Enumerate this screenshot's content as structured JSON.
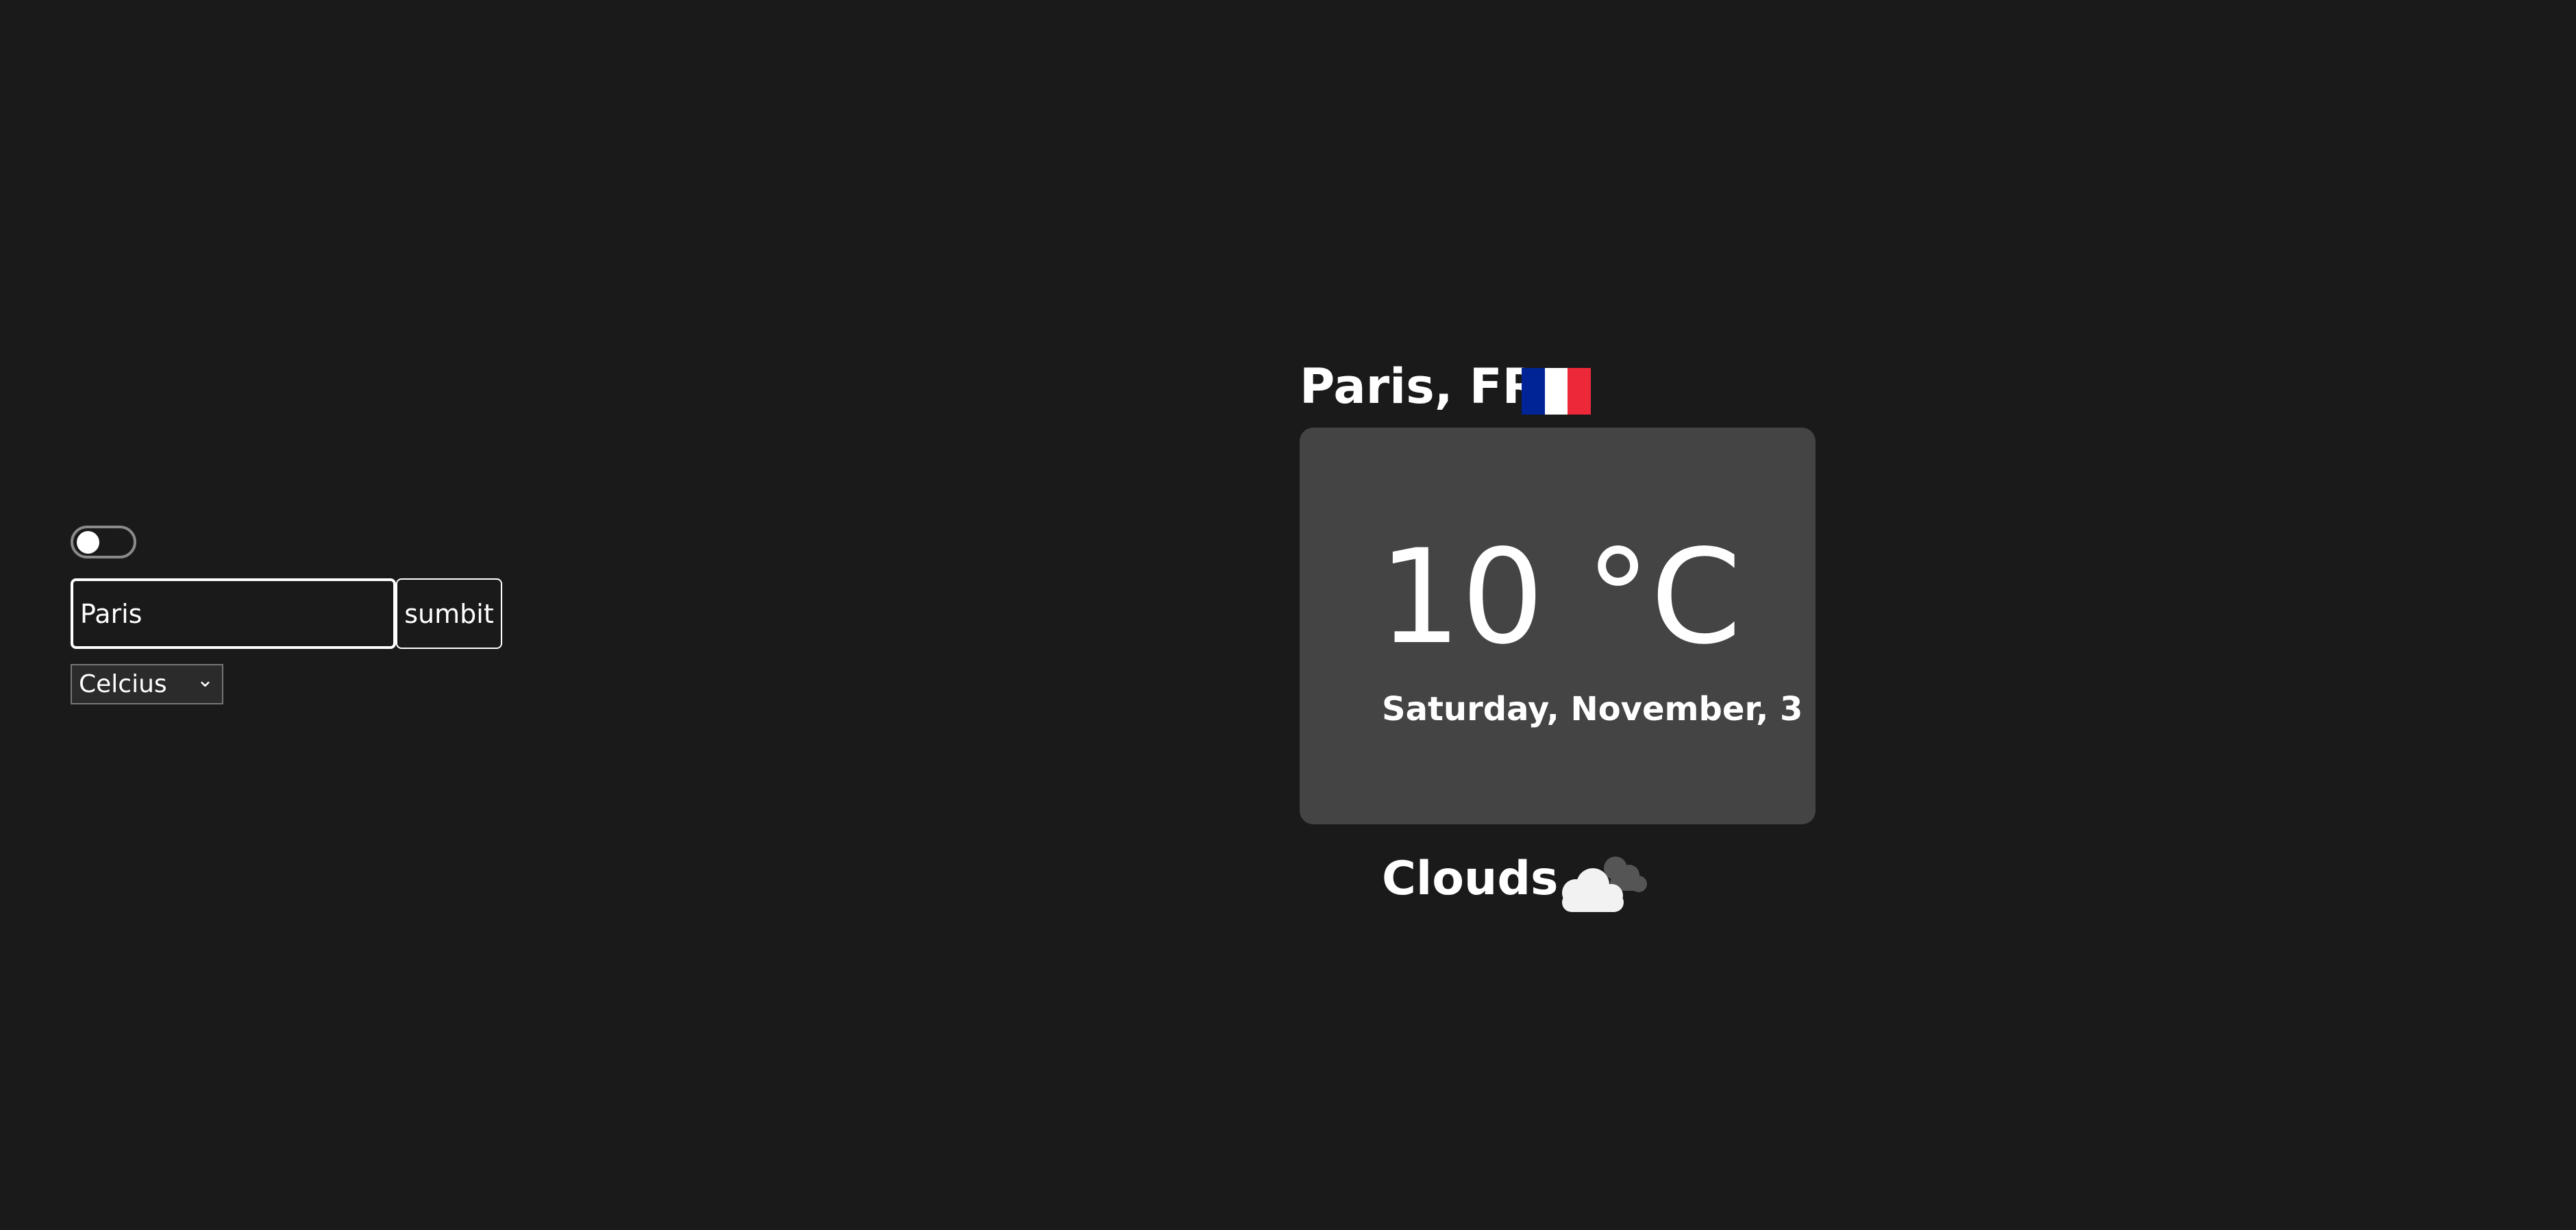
{
  "controls": {
    "theme_toggle_on": false,
    "city_input_value": "Paris",
    "submit_label": "sumbit",
    "unit_selected": "Celcius"
  },
  "weather": {
    "location": "Paris, FR",
    "flag_icon": "france-flag-icon",
    "flag_colors": [
      "#002395",
      "#ffffff",
      "#ED2939"
    ],
    "temperature": "10 °C",
    "date": "Saturday, November, 3",
    "condition": "Clouds",
    "condition_icon": "clouds-icon"
  },
  "colors": {
    "background": "#1a1a1a",
    "card": "#444444",
    "text": "#ffffff"
  }
}
